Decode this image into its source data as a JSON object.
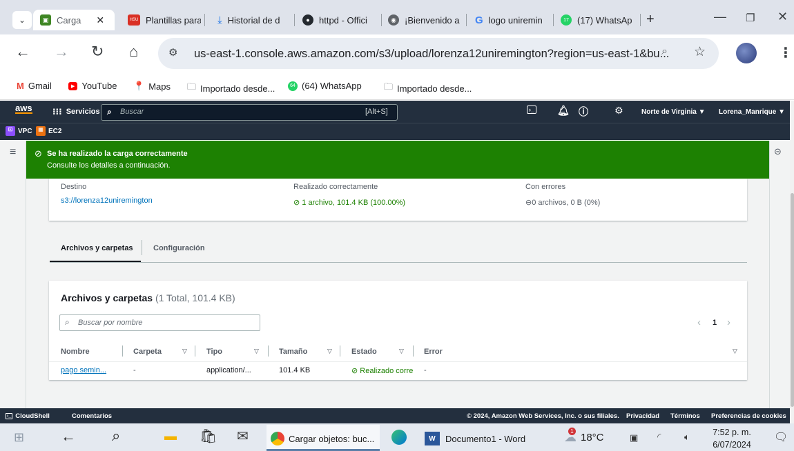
{
  "browser": {
    "tabs": [
      {
        "label": "Carga",
        "icon": "s3-icon"
      },
      {
        "label": "Plantillas para",
        "icon": "hsu-icon",
        "badge": "HSU"
      },
      {
        "label": "Historial de d",
        "icon": "download-icon"
      },
      {
        "label": "httpd - Offici",
        "icon": "github-icon"
      },
      {
        "label": "¡Bienvenido a",
        "icon": "globe-icon"
      },
      {
        "label": "logo uniremin",
        "icon": "google-icon",
        "glyph": "G"
      },
      {
        "label": "(17) WhatsAp",
        "icon": "whatsapp-icon",
        "badge": "17"
      }
    ],
    "url": "us-east-1.console.aws.amazon.com/s3/upload/lorenza12uniremington?region=us-east-1&bu...",
    "bookmarks": [
      {
        "label": "Gmail"
      },
      {
        "label": "YouTube"
      },
      {
        "label": "Maps"
      },
      {
        "label": "Importado desde..."
      },
      {
        "label": "(64) WhatsApp",
        "badge": "64"
      },
      {
        "label": "Importado desde..."
      }
    ]
  },
  "aws": {
    "logo": "aws",
    "services": "Servicios",
    "search_placeholder": "Buscar",
    "search_shortcut": "[Alt+S]",
    "region": "Norte de Virginia ▼",
    "user": "Lorena_Manrique ▼",
    "favorites": [
      "VPC",
      "EC2"
    ],
    "colors": {
      "nav": "#232f3e",
      "success": "#1d8102",
      "link": "#0073bb",
      "orange": "#ec7211"
    }
  },
  "flash": {
    "title": "Se ha realizado la carga correctamente",
    "subtitle": "Consulte los detalles a continuación."
  },
  "summary": {
    "dest_label": "Destino",
    "dest_value": "s3://lorenza12uniremington",
    "ok_label": "Realizado correctamente",
    "ok_value": "1 archivo, 101.4 KB (100.00%)",
    "err_label": "Con errores",
    "err_value": "0 archivos, 0 B (0%)"
  },
  "tabs": {
    "files": "Archivos y carpetas",
    "config": "Configuración"
  },
  "files_panel": {
    "title": "Archivos y carpetas",
    "count": "(1 Total, 101.4 KB)",
    "search_placeholder": "Buscar por nombre",
    "page": "1",
    "columns": [
      "Nombre",
      "Carpeta",
      "Tipo",
      "Tamaño",
      "Estado",
      "Error"
    ],
    "rows": [
      {
        "name": "pago semin...",
        "folder": "-",
        "type": "application/...",
        "size": "101.4 KB",
        "status": "Realizado corre",
        "error": "-"
      }
    ]
  },
  "footer": {
    "cloudshell": "CloudShell",
    "comments": "Comentarios",
    "copyright": "© 2024, Amazon Web Services, Inc. o sus filiales.",
    "privacy": "Privacidad",
    "terms": "Términos",
    "cookies": "Preferencias de cookies"
  },
  "taskbar": {
    "chrome_label": "Cargar objetos: buc...",
    "word_label": "Documento1 - Word",
    "weather": "18°C",
    "weather_badge": "1",
    "time": "7:52 p. m.",
    "date": "6/07/2024"
  }
}
